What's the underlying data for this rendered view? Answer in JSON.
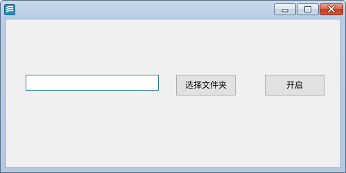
{
  "window": {
    "title": "",
    "icon": "app-icon",
    "controls": [
      "minimize-icon",
      "maximize-icon",
      "close-icon"
    ]
  },
  "form": {
    "path_input_value": "",
    "choose_folder_label": "选择文件夹",
    "start_label": "开启"
  },
  "colors": {
    "titlebar": "#b8cde6",
    "client_bg": "#f0f0f0",
    "button_bg": "#e1e1e1",
    "input_border": "#2f78a7",
    "close_button": "#c43c1f"
  }
}
